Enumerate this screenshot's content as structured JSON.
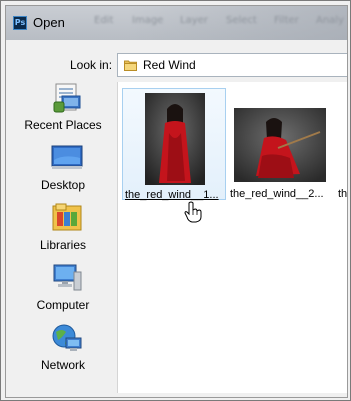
{
  "window": {
    "title": "Open",
    "app_icon_text": "Ps",
    "background_menu": [
      "Edit",
      "Image",
      "Layer",
      "Select",
      "Filter",
      "Analy"
    ]
  },
  "look_in": {
    "label": "Look in:",
    "value": "Red Wind"
  },
  "places": [
    {
      "label": "Recent Places",
      "icon": "recent-places-icon"
    },
    {
      "label": "Desktop",
      "icon": "desktop-icon"
    },
    {
      "label": "Libraries",
      "icon": "libraries-icon"
    },
    {
      "label": "Computer",
      "icon": "computer-icon"
    },
    {
      "label": "Network",
      "icon": "network-icon"
    }
  ],
  "files": [
    {
      "name": "the_red_wind__1...",
      "selected": true
    },
    {
      "name": "the_red_wind__2...",
      "selected": false
    },
    {
      "name": "th",
      "selected": false
    }
  ],
  "colors": {
    "dress_red": "#c4141c",
    "selection_border": "#a8d0f0"
  }
}
